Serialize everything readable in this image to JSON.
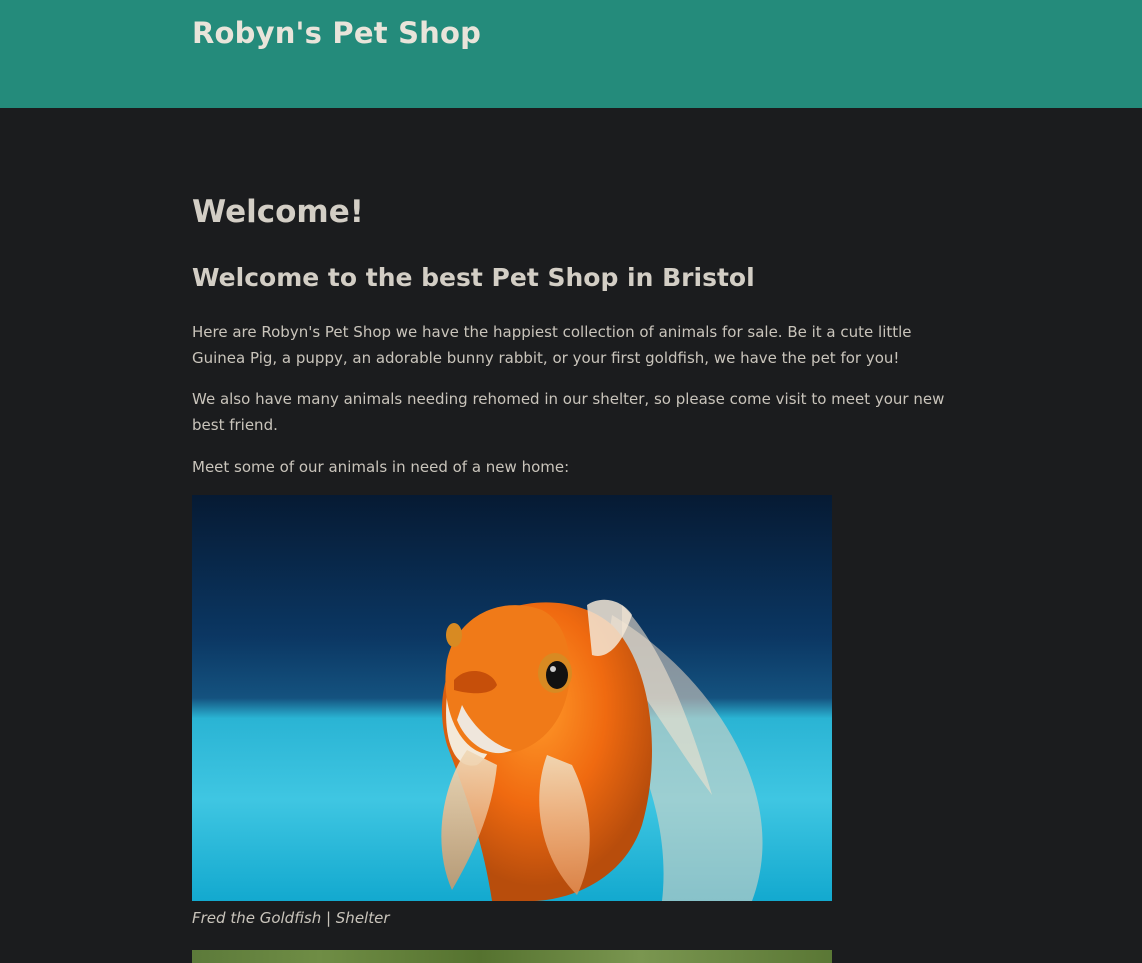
{
  "header": {
    "title": "Robyn's Pet Shop",
    "background_color": "#248b7b"
  },
  "main": {
    "heading": "Welcome!",
    "subheading": "Welcome to the best Pet Shop in Bristol",
    "paragraphs": [
      "Here are Robyn's Pet Shop we have the happiest collection of animals for sale. Be it a cute little Guinea Pig, a puppy, an adorable bunny rabbit, or your first goldfish, we have the pet for you!",
      "We also have many animals needing rehomed in our shelter, so please come visit to meet your new best friend.",
      "Meet some of our animals in need of a new home:"
    ],
    "pets": [
      {
        "image_subject": "goldfish photo",
        "caption": "Fred the Goldfish | Shelter"
      },
      {
        "image_subject": "grass photo (partially visible)"
      }
    ]
  },
  "colors": {
    "page_background": "#1b1c1e",
    "text": "#c9c4bb"
  }
}
